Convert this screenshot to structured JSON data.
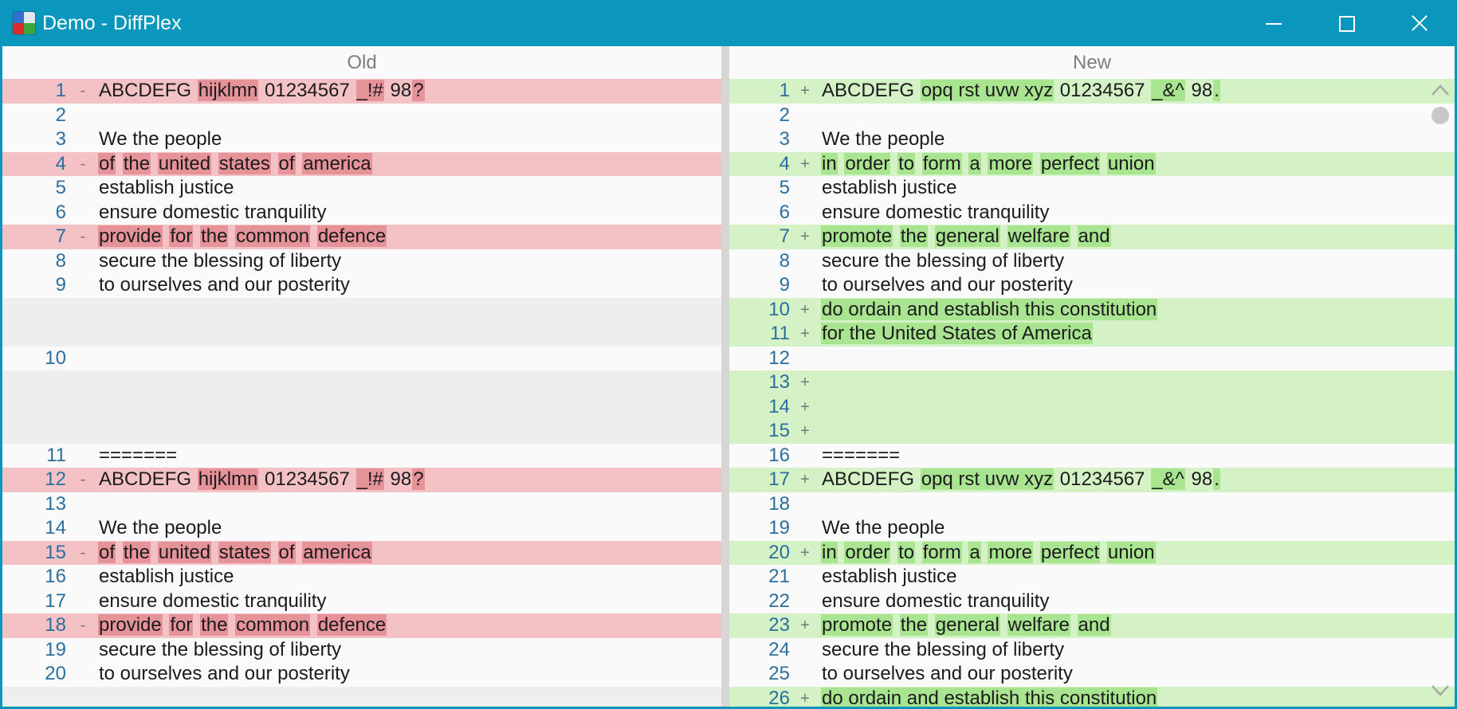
{
  "window": {
    "title": "Demo - DiffPlex"
  },
  "left": {
    "header": "Old",
    "rows": [
      {
        "type": "del",
        "num": "1",
        "mark": "-",
        "segs": [
          {
            "t": "ABCDEFG ",
            "h": false
          },
          {
            "t": "hijklmn",
            "h": true
          },
          {
            "t": " 01234567 ",
            "h": false
          },
          {
            "t": "_!#",
            "h": true
          },
          {
            "t": " 98",
            "h": false
          },
          {
            "t": "?",
            "h": true
          }
        ]
      },
      {
        "type": "same",
        "num": "2",
        "mark": "",
        "segs": []
      },
      {
        "type": "same",
        "num": "3",
        "mark": "",
        "segs": [
          {
            "t": "We the people",
            "h": false
          }
        ]
      },
      {
        "type": "del",
        "num": "4",
        "mark": "-",
        "segs": [
          {
            "t": "of",
            "h": true
          },
          {
            "t": " ",
            "h": false
          },
          {
            "t": "the",
            "h": true
          },
          {
            "t": " ",
            "h": false
          },
          {
            "t": "united",
            "h": true
          },
          {
            "t": " ",
            "h": false
          },
          {
            "t": "states",
            "h": true
          },
          {
            "t": " ",
            "h": false
          },
          {
            "t": "of",
            "h": true
          },
          {
            "t": " ",
            "h": false
          },
          {
            "t": "america",
            "h": true
          }
        ]
      },
      {
        "type": "same",
        "num": "5",
        "mark": "",
        "segs": [
          {
            "t": "establish justice",
            "h": false
          }
        ]
      },
      {
        "type": "same",
        "num": "6",
        "mark": "",
        "segs": [
          {
            "t": "ensure domestic tranquility",
            "h": false
          }
        ]
      },
      {
        "type": "del",
        "num": "7",
        "mark": "-",
        "segs": [
          {
            "t": "provide",
            "h": true
          },
          {
            "t": " ",
            "h": false
          },
          {
            "t": "for",
            "h": true
          },
          {
            "t": " ",
            "h": false
          },
          {
            "t": "the",
            "h": true
          },
          {
            "t": " ",
            "h": false
          },
          {
            "t": "common",
            "h": true
          },
          {
            "t": " ",
            "h": false
          },
          {
            "t": "defence",
            "h": true
          }
        ]
      },
      {
        "type": "same",
        "num": "8",
        "mark": "",
        "segs": [
          {
            "t": "secure the blessing of liberty",
            "h": false
          }
        ]
      },
      {
        "type": "same",
        "num": "9",
        "mark": "",
        "segs": [
          {
            "t": "to ourselves and our posterity",
            "h": false
          }
        ]
      },
      {
        "type": "imag",
        "num": "",
        "mark": "",
        "segs": []
      },
      {
        "type": "imag",
        "num": "",
        "mark": "",
        "segs": []
      },
      {
        "type": "same",
        "num": "10",
        "mark": "",
        "segs": []
      },
      {
        "type": "imag",
        "num": "",
        "mark": "",
        "segs": []
      },
      {
        "type": "imag",
        "num": "",
        "mark": "",
        "segs": []
      },
      {
        "type": "imag",
        "num": "",
        "mark": "",
        "segs": []
      },
      {
        "type": "same",
        "num": "11",
        "mark": "",
        "segs": [
          {
            "t": "=======",
            "h": false
          }
        ]
      },
      {
        "type": "del",
        "num": "12",
        "mark": "-",
        "segs": [
          {
            "t": "ABCDEFG ",
            "h": false
          },
          {
            "t": "hijklmn",
            "h": true
          },
          {
            "t": " 01234567 ",
            "h": false
          },
          {
            "t": "_!#",
            "h": true
          },
          {
            "t": " 98",
            "h": false
          },
          {
            "t": "?",
            "h": true
          }
        ]
      },
      {
        "type": "same",
        "num": "13",
        "mark": "",
        "segs": []
      },
      {
        "type": "same",
        "num": "14",
        "mark": "",
        "segs": [
          {
            "t": "We the people",
            "h": false
          }
        ]
      },
      {
        "type": "del",
        "num": "15",
        "mark": "-",
        "segs": [
          {
            "t": "of",
            "h": true
          },
          {
            "t": " ",
            "h": false
          },
          {
            "t": "the",
            "h": true
          },
          {
            "t": " ",
            "h": false
          },
          {
            "t": "united",
            "h": true
          },
          {
            "t": " ",
            "h": false
          },
          {
            "t": "states",
            "h": true
          },
          {
            "t": " ",
            "h": false
          },
          {
            "t": "of",
            "h": true
          },
          {
            "t": " ",
            "h": false
          },
          {
            "t": "america",
            "h": true
          }
        ]
      },
      {
        "type": "same",
        "num": "16",
        "mark": "",
        "segs": [
          {
            "t": "establish justice",
            "h": false
          }
        ]
      },
      {
        "type": "same",
        "num": "17",
        "mark": "",
        "segs": [
          {
            "t": "ensure domestic tranquility",
            "h": false
          }
        ]
      },
      {
        "type": "del",
        "num": "18",
        "mark": "-",
        "segs": [
          {
            "t": "provide",
            "h": true
          },
          {
            "t": " ",
            "h": false
          },
          {
            "t": "for",
            "h": true
          },
          {
            "t": " ",
            "h": false
          },
          {
            "t": "the",
            "h": true
          },
          {
            "t": " ",
            "h": false
          },
          {
            "t": "common",
            "h": true
          },
          {
            "t": " ",
            "h": false
          },
          {
            "t": "defence",
            "h": true
          }
        ]
      },
      {
        "type": "same",
        "num": "19",
        "mark": "",
        "segs": [
          {
            "t": "secure the blessing of liberty",
            "h": false
          }
        ]
      },
      {
        "type": "same",
        "num": "20",
        "mark": "",
        "segs": [
          {
            "t": "to ourselves and our posterity",
            "h": false
          }
        ]
      },
      {
        "type": "imag",
        "num": "",
        "mark": "",
        "segs": []
      }
    ]
  },
  "right": {
    "header": "New",
    "rows": [
      {
        "type": "add",
        "num": "1",
        "mark": "+",
        "segs": [
          {
            "t": "ABCDEFG ",
            "h": false
          },
          {
            "t": "opq rst uvw xyz",
            "h": true
          },
          {
            "t": " 01234567 ",
            "h": false
          },
          {
            "t": "_&^",
            "h": true
          },
          {
            "t": " 98",
            "h": false
          },
          {
            "t": ".",
            "h": true
          }
        ]
      },
      {
        "type": "same",
        "num": "2",
        "mark": "",
        "segs": []
      },
      {
        "type": "same",
        "num": "3",
        "mark": "",
        "segs": [
          {
            "t": "We the people",
            "h": false
          }
        ]
      },
      {
        "type": "add",
        "num": "4",
        "mark": "+",
        "segs": [
          {
            "t": "in",
            "h": true
          },
          {
            "t": " ",
            "h": false
          },
          {
            "t": "order",
            "h": true
          },
          {
            "t": " ",
            "h": false
          },
          {
            "t": "to",
            "h": true
          },
          {
            "t": " ",
            "h": false
          },
          {
            "t": "form",
            "h": true
          },
          {
            "t": " ",
            "h": false
          },
          {
            "t": "a",
            "h": true
          },
          {
            "t": " ",
            "h": false
          },
          {
            "t": "more",
            "h": true
          },
          {
            "t": " ",
            "h": false
          },
          {
            "t": "perfect",
            "h": true
          },
          {
            "t": " ",
            "h": false
          },
          {
            "t": "union",
            "h": true
          }
        ]
      },
      {
        "type": "same",
        "num": "5",
        "mark": "",
        "segs": [
          {
            "t": "establish justice",
            "h": false
          }
        ]
      },
      {
        "type": "same",
        "num": "6",
        "mark": "",
        "segs": [
          {
            "t": "ensure domestic tranquility",
            "h": false
          }
        ]
      },
      {
        "type": "add",
        "num": "7",
        "mark": "+",
        "segs": [
          {
            "t": "promote",
            "h": true
          },
          {
            "t": " ",
            "h": false
          },
          {
            "t": "the",
            "h": true
          },
          {
            "t": " ",
            "h": false
          },
          {
            "t": "general",
            "h": true
          },
          {
            "t": " ",
            "h": false
          },
          {
            "t": "welfare",
            "h": true
          },
          {
            "t": " ",
            "h": false
          },
          {
            "t": "and",
            "h": true
          }
        ]
      },
      {
        "type": "same",
        "num": "8",
        "mark": "",
        "segs": [
          {
            "t": "secure the blessing of liberty",
            "h": false
          }
        ]
      },
      {
        "type": "same",
        "num": "9",
        "mark": "",
        "segs": [
          {
            "t": "to ourselves and our posterity",
            "h": false
          }
        ]
      },
      {
        "type": "add",
        "num": "10",
        "mark": "+",
        "segs": [
          {
            "t": "do ordain and establish this constitution",
            "h": true
          }
        ]
      },
      {
        "type": "add",
        "num": "11",
        "mark": "+",
        "segs": [
          {
            "t": "for the United States of America",
            "h": true
          }
        ]
      },
      {
        "type": "same",
        "num": "12",
        "mark": "",
        "segs": []
      },
      {
        "type": "add",
        "num": "13",
        "mark": "+",
        "segs": []
      },
      {
        "type": "add",
        "num": "14",
        "mark": "+",
        "segs": []
      },
      {
        "type": "add",
        "num": "15",
        "mark": "+",
        "segs": []
      },
      {
        "type": "same",
        "num": "16",
        "mark": "",
        "segs": [
          {
            "t": "=======",
            "h": false
          }
        ]
      },
      {
        "type": "add",
        "num": "17",
        "mark": "+",
        "segs": [
          {
            "t": "ABCDEFG ",
            "h": false
          },
          {
            "t": "opq rst uvw xyz",
            "h": true
          },
          {
            "t": " 01234567 ",
            "h": false
          },
          {
            "t": "_&^",
            "h": true
          },
          {
            "t": " 98",
            "h": false
          },
          {
            "t": ".",
            "h": true
          }
        ]
      },
      {
        "type": "same",
        "num": "18",
        "mark": "",
        "segs": []
      },
      {
        "type": "same",
        "num": "19",
        "mark": "",
        "segs": [
          {
            "t": "We the people",
            "h": false
          }
        ]
      },
      {
        "type": "add",
        "num": "20",
        "mark": "+",
        "segs": [
          {
            "t": "in",
            "h": true
          },
          {
            "t": " ",
            "h": false
          },
          {
            "t": "order",
            "h": true
          },
          {
            "t": " ",
            "h": false
          },
          {
            "t": "to",
            "h": true
          },
          {
            "t": " ",
            "h": false
          },
          {
            "t": "form",
            "h": true
          },
          {
            "t": " ",
            "h": false
          },
          {
            "t": "a",
            "h": true
          },
          {
            "t": " ",
            "h": false
          },
          {
            "t": "more",
            "h": true
          },
          {
            "t": " ",
            "h": false
          },
          {
            "t": "perfect",
            "h": true
          },
          {
            "t": " ",
            "h": false
          },
          {
            "t": "union",
            "h": true
          }
        ]
      },
      {
        "type": "same",
        "num": "21",
        "mark": "",
        "segs": [
          {
            "t": "establish justice",
            "h": false
          }
        ]
      },
      {
        "type": "same",
        "num": "22",
        "mark": "",
        "segs": [
          {
            "t": "ensure domestic tranquility",
            "h": false
          }
        ]
      },
      {
        "type": "add",
        "num": "23",
        "mark": "+",
        "segs": [
          {
            "t": "promote",
            "h": true
          },
          {
            "t": " ",
            "h": false
          },
          {
            "t": "the",
            "h": true
          },
          {
            "t": " ",
            "h": false
          },
          {
            "t": "general",
            "h": true
          },
          {
            "t": " ",
            "h": false
          },
          {
            "t": "welfare",
            "h": true
          },
          {
            "t": " ",
            "h": false
          },
          {
            "t": "and",
            "h": true
          }
        ]
      },
      {
        "type": "same",
        "num": "24",
        "mark": "",
        "segs": [
          {
            "t": "secure the blessing of liberty",
            "h": false
          }
        ]
      },
      {
        "type": "same",
        "num": "25",
        "mark": "",
        "segs": [
          {
            "t": "to ourselves and our posterity",
            "h": false
          }
        ]
      },
      {
        "type": "add",
        "num": "26",
        "mark": "+",
        "segs": [
          {
            "t": "do ordain and establish this constitution",
            "h": true
          }
        ]
      }
    ]
  },
  "colors": {
    "titlebar": "#0b97bd",
    "deleted_line": "#f4c2c5",
    "deleted_word": "#e69299",
    "inserted_line": "#d4f2c5",
    "inserted_word": "#a9e491",
    "imaginary_line": "#eeeeee",
    "line_number": "#2b6f9e"
  },
  "icons": {
    "app": "diffplex-app-icon",
    "minimize": "minimize-icon",
    "maximize": "maximize-icon",
    "close": "close-icon",
    "scroll_up": "chevron-up-icon",
    "scroll_down": "chevron-down-icon"
  }
}
